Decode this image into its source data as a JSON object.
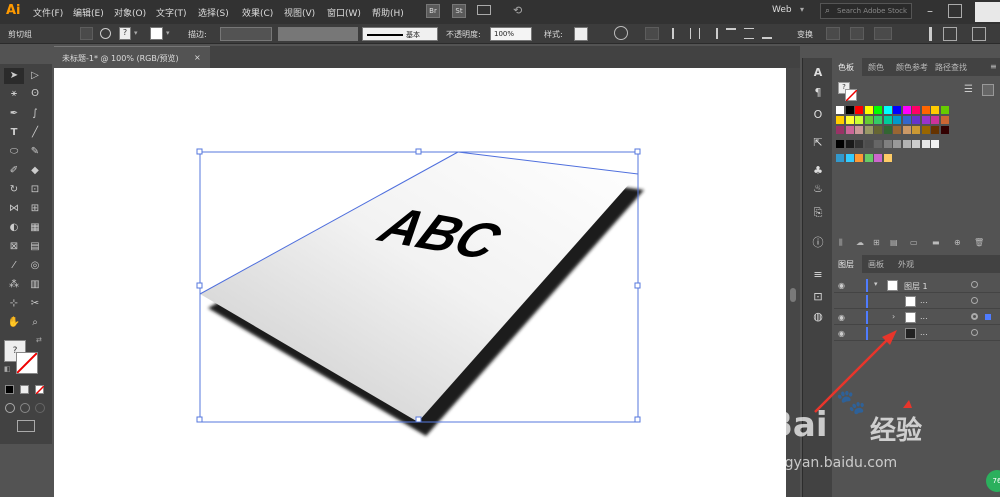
{
  "app": {
    "logo": "Ai"
  },
  "menu": {
    "items": [
      "文件(F)",
      "编辑(E)",
      "对象(O)",
      "文字(T)",
      "选择(S)",
      "效果(C)",
      "视图(V)",
      "窗口(W)",
      "帮助(H)"
    ],
    "br": "Br",
    "st": "St",
    "workspace": "Web",
    "search_placeholder": "Search Adobe Stock"
  },
  "control": {
    "selection": "剪切组",
    "stroke_label": "描边:",
    "stroke_style": "基本",
    "opacity_label": "不透明度:",
    "opacity_value": "100%",
    "style_label": "样式:",
    "transform": "变换"
  },
  "doc_tab": {
    "title": "未标题-1* @ 100% (RGB/预览)",
    "close": "×"
  },
  "artwork": {
    "text": "ABC"
  },
  "swatch_panel": {
    "tabs": [
      "色板",
      "颜色",
      "颜色参考",
      "路径查找"
    ]
  },
  "layers_panel": {
    "tabs": [
      "图层",
      "画板",
      "外观"
    ],
    "layer_name": "图层 1",
    "dots": "..."
  },
  "watermark": {
    "brand": "Bai",
    "brand2": "经验",
    "url": "jingyan.baidu.com",
    "badge": "76"
  },
  "colors": {
    "swatch_row1": [
      "#ffffff",
      "#000000",
      "#ff0000",
      "#ffff00",
      "#00ff00",
      "#00ffff",
      "#0000ff",
      "#ff00ff",
      "#ff0066",
      "#ff6600",
      "#ffcc00",
      "#66cc00"
    ],
    "swatch_row2": [
      "#ffcc00",
      "#ffff33",
      "#ccff33",
      "#66cc33",
      "#33cc66",
      "#00cc99",
      "#0099cc",
      "#3366cc",
      "#6633cc",
      "#9933cc",
      "#cc3399",
      "#cc6633"
    ],
    "swatch_row3": [
      "#993366",
      "#cc6699",
      "#cc9999",
      "#999966",
      "#666633",
      "#336633",
      "#996633",
      "#cc9966",
      "#cc9933",
      "#996600",
      "#663300",
      "#330000"
    ],
    "swatch_row4": [
      "#000000",
      "#1a1a1a",
      "#333333",
      "#4d4d4d",
      "#666666",
      "#808080",
      "#999999",
      "#b3b3b3",
      "#cccccc",
      "#e6e6e6",
      "#f2f2f2"
    ],
    "swatch_row5": [
      "#3399cc",
      "#33ccff",
      "#ff9933",
      "#66cc66",
      "#cc66cc",
      "#ffcc66"
    ]
  }
}
